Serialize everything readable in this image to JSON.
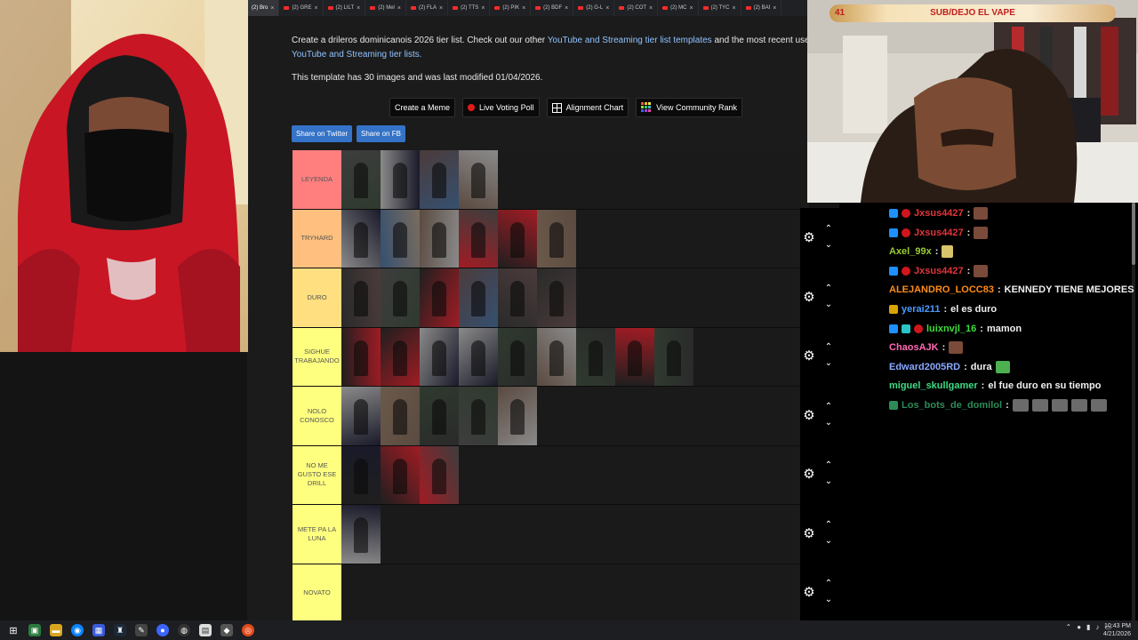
{
  "browser": {
    "tabs": [
      {
        "label": "(2) Bro"
      },
      {
        "label": "(2) GRE"
      },
      {
        "label": "(2) LILT"
      },
      {
        "label": "(2) Mel"
      },
      {
        "label": "(2) FLA"
      },
      {
        "label": "(2) TTS"
      },
      {
        "label": "(2) PIK"
      },
      {
        "label": "(2) BDF"
      },
      {
        "label": "(2) G-L"
      },
      {
        "label": "(2) COT"
      },
      {
        "label": "(2) MC"
      },
      {
        "label": "(2) TYC"
      },
      {
        "label": "(2) BAI"
      }
    ]
  },
  "page": {
    "intro_prefix": "Create a drileros dominicanois 2026 tier list. Check out our other ",
    "intro_link1": "YouTube and Streaming tier list templates",
    "intro_middle": " and the most recent user submi",
    "intro_link2": "YouTube and Streaming tier lists.",
    "modified_text": "This template has 30 images and was last modified 01/04/2026.",
    "buttons": {
      "create_meme": "Create a Meme",
      "live_voting": "Live Voting Poll",
      "alignment": "Alignment Chart",
      "community_rank": "View Community Rank"
    },
    "share_twitter": "Share on Twitter",
    "share_fb": "Share on FB"
  },
  "tiers": [
    {
      "label": "LEYENDA",
      "color": "#ff7f7f",
      "items": 4
    },
    {
      "label": "TRYHARD",
      "color": "#ffbf7f",
      "items": 6
    },
    {
      "label": "DURO",
      "color": "#ffdf7f",
      "items": 6
    },
    {
      "label": "SIGHUE TRABAJANDO",
      "color": "#ffff7f",
      "items": 9
    },
    {
      "label": "NOLO CONOSCO",
      "color": "#ffff7f",
      "items": 5
    },
    {
      "label": "NO ME GUSTO ESE DRILL",
      "color": "#ffff7f",
      "items": 3
    },
    {
      "label": "METE PA LA LUNA",
      "color": "#ffff7f",
      "items": 1
    },
    {
      "label": "NOVATO",
      "color": "#ffff7f",
      "items": 0
    }
  ],
  "stream": {
    "viewer_count": "41",
    "title": "SUB/DEJO EL VAPE"
  },
  "chat": [
    {
      "user": "Jxsus4427",
      "color": "#e0353b",
      "text": "",
      "badges": [
        "prime",
        "dot"
      ],
      "emote": "brown"
    },
    {
      "user": "Jxsus4427",
      "color": "#e0353b",
      "text": "",
      "badges": [
        "prime",
        "dot"
      ],
      "emote": "brown"
    },
    {
      "user": "Axel_99x",
      "color": "#9acd32",
      "text": "",
      "badges": [],
      "emote": "yellow"
    },
    {
      "user": "Jxsus4427",
      "color": "#e0353b",
      "text": "",
      "badges": [
        "prime",
        "dot"
      ],
      "emote": "brown"
    },
    {
      "user": "ALEJANDRO_LOCC83",
      "color": "#ff8c1a",
      "text": "KENNEDY TIENE MEJORES",
      "badges": [],
      "emote": ""
    },
    {
      "user": "yerai211",
      "color": "#4a9bff",
      "text": "el es duro",
      "badges": [
        "gold"
      ],
      "emote": ""
    },
    {
      "user": "luixnvjl_16",
      "color": "#3ddc3d",
      "text": "mamon",
      "badges": [
        "prime",
        "teal",
        "dot"
      ],
      "emote": ""
    },
    {
      "user": "ChaosAJK",
      "color": "#ff69b4",
      "text": "",
      "badges": [],
      "emote": "brown"
    },
    {
      "user": "Edward2005RD",
      "color": "#8aa8ff",
      "text": "dura",
      "badges": [],
      "emote": "green"
    },
    {
      "user": "miguel_skullgamer",
      "color": "#3ddc84",
      "text": "el fue duro en su tiempo",
      "badges": [],
      "emote": ""
    },
    {
      "user": "Los_bots_de_domilol",
      "color": "#2e8b57",
      "text": "",
      "badges": [
        "green"
      ],
      "emote": "gray5"
    }
  ],
  "taskbar": {
    "time": "10:43 PM",
    "date": "4/21/2026"
  }
}
